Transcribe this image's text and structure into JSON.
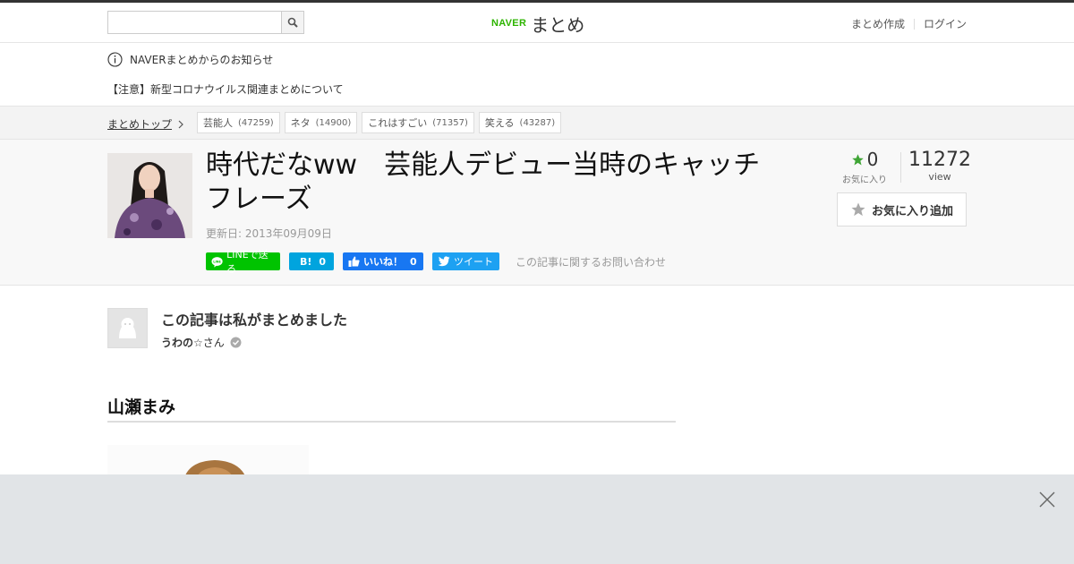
{
  "header": {
    "search_placeholder": "",
    "search_icon": "magnifier-icon",
    "logo_brand": "NAVER",
    "logo_name": "まとめ",
    "links": [
      "まとめ作成",
      "ログイン"
    ]
  },
  "notice": {
    "info_icon": "info-circle-icon",
    "title": "NAVERまとめからのお知らせ",
    "message": "【注意】新型コロナウイルス関連まとめについて"
  },
  "breadcrumb": {
    "home": "まとめトップ",
    "tags": [
      {
        "label": "芸能人",
        "count": "(47259)"
      },
      {
        "label": "ネタ",
        "count": "(14900)"
      },
      {
        "label": "これはすごい",
        "count": "(71357)"
      },
      {
        "label": "笑える",
        "count": "(43287)"
      }
    ]
  },
  "article": {
    "title": "時代だなww　芸能人デビュー当時のキャッチフレーズ",
    "updated": "更新日: 2013年09月09日",
    "favorite_count": "0",
    "favorite_label": "お気に入り",
    "view_count": "11272",
    "view_label": "view",
    "add_favorite": "お気に入り追加",
    "inquiry": "この記事に関するお問い合わせ"
  },
  "social": {
    "line": "LINEで送る",
    "hatena_mark": "B!",
    "hatena_count": "0",
    "fb_label": "いいね！",
    "fb_count": "0",
    "tweet": "ツイート"
  },
  "curator": {
    "heading": "この記事は私がまとめました",
    "name": "うわの☆",
    "suffix": "さん"
  },
  "content": {
    "section_heading": "山瀬まみ"
  },
  "colors": {
    "naver_green": "#2db400",
    "line_green": "#00c300",
    "hatena_blue": "#00a4de",
    "facebook_blue": "#1877f2",
    "twitter_blue": "#1da1f2",
    "star_green": "#3fa535"
  }
}
